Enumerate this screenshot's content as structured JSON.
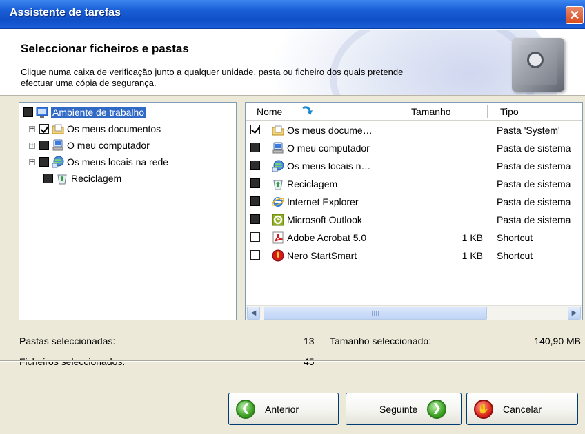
{
  "window": {
    "title": "Assistente de tarefas",
    "close_glyph": "✕"
  },
  "header": {
    "title": "Seleccionar ficheiros e pastas",
    "description": "Clique numa caixa de verificação junto a qualquer unidade, pasta ou ficheiro dos quais pretende efectuar uma cópia de segurança.",
    "icon": "safe-icon"
  },
  "tree": {
    "items": [
      {
        "label": "Ambiente de trabalho",
        "state": "filled",
        "icon": "desktop-icon",
        "expander": ""
      },
      {
        "label": "Os meus documentos",
        "state": "checked",
        "icon": "documents-folder-icon",
        "expander": "+"
      },
      {
        "label": "O meu computador",
        "state": "filled",
        "icon": "computer-icon",
        "expander": "+"
      },
      {
        "label": "Os meus locais na rede",
        "state": "filled",
        "icon": "network-icon",
        "expander": "+"
      },
      {
        "label": "Reciclagem",
        "state": "filled",
        "icon": "recycle-bin-icon",
        "expander": ""
      }
    ]
  },
  "list": {
    "columns": {
      "name": "Nome",
      "size": "Tamanho",
      "type": "Tipo"
    },
    "rows": [
      {
        "name": "Os meus docume…",
        "size": "",
        "type": "Pasta 'System'",
        "state": "checked",
        "icon": "documents-folder-icon"
      },
      {
        "name": "O meu computador",
        "size": "",
        "type": "Pasta de sistema",
        "state": "filled",
        "icon": "computer-icon"
      },
      {
        "name": "Os meus locais n…",
        "size": "",
        "type": "Pasta de sistema",
        "state": "filled",
        "icon": "network-icon"
      },
      {
        "name": "Reciclagem",
        "size": "",
        "type": "Pasta de sistema",
        "state": "filled",
        "icon": "recycle-bin-icon"
      },
      {
        "name": "Internet Explorer",
        "size": "",
        "type": "Pasta de sistema",
        "state": "filled",
        "icon": "internet-explorer-icon"
      },
      {
        "name": "Microsoft Outlook",
        "size": "",
        "type": "Pasta de sistema",
        "state": "filled",
        "icon": "outlook-icon"
      },
      {
        "name": "Adobe Acrobat 5.0",
        "size": "1 KB",
        "type": "Shortcut",
        "state": "unchecked",
        "icon": "acrobat-icon"
      },
      {
        "name": "Nero StartSmart",
        "size": "1 KB",
        "type": "Shortcut",
        "state": "unchecked",
        "icon": "nero-icon"
      }
    ]
  },
  "stats": {
    "folders_label": "Pastas seleccionadas:",
    "folders_value": "13",
    "files_label": "Ficheiros seleccionados:",
    "files_value": "45",
    "size_label": "Tamanho seleccionado:",
    "size_value": "140,90 MB"
  },
  "buttons": {
    "back": "Anterior",
    "next": "Seguinte",
    "cancel": "Cancelar"
  },
  "colors": {
    "titlebar": "#1a5fd6",
    "selection": "#316ac5",
    "dialog_bg": "#ece9d8"
  }
}
